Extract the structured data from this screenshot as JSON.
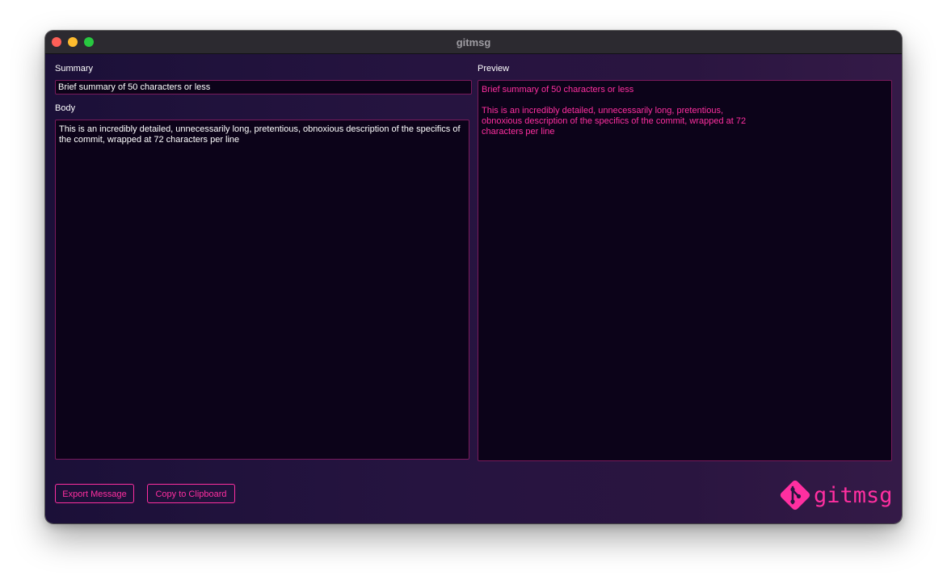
{
  "window": {
    "title": "gitmsg"
  },
  "summary": {
    "label": "Summary",
    "value": "Brief summary of 50 characters or less"
  },
  "body": {
    "label": "Body",
    "value": "This is an incredibly detailed, unnecessarily long, pretentious, obnoxious description of the specifics of the commit, wrapped at 72 characters per line"
  },
  "preview": {
    "label": "Preview",
    "summary": "Brief summary of 50 characters or less",
    "body": "This is an incredibly detailed, unnecessarily long, pretentious,\nobnoxious description of the specifics of the commit, wrapped at 72\ncharacters per line"
  },
  "actions": {
    "export_label": "Export Message",
    "copy_label": "Copy to Clipboard"
  },
  "logo": {
    "text": "gitmsg",
    "icon": "git-diamond-icon"
  },
  "colors": {
    "accent": "#ff2fa0",
    "border": "#7a1a5c",
    "field_bg": "#0c0319",
    "titlebar": "#2c2a30"
  }
}
